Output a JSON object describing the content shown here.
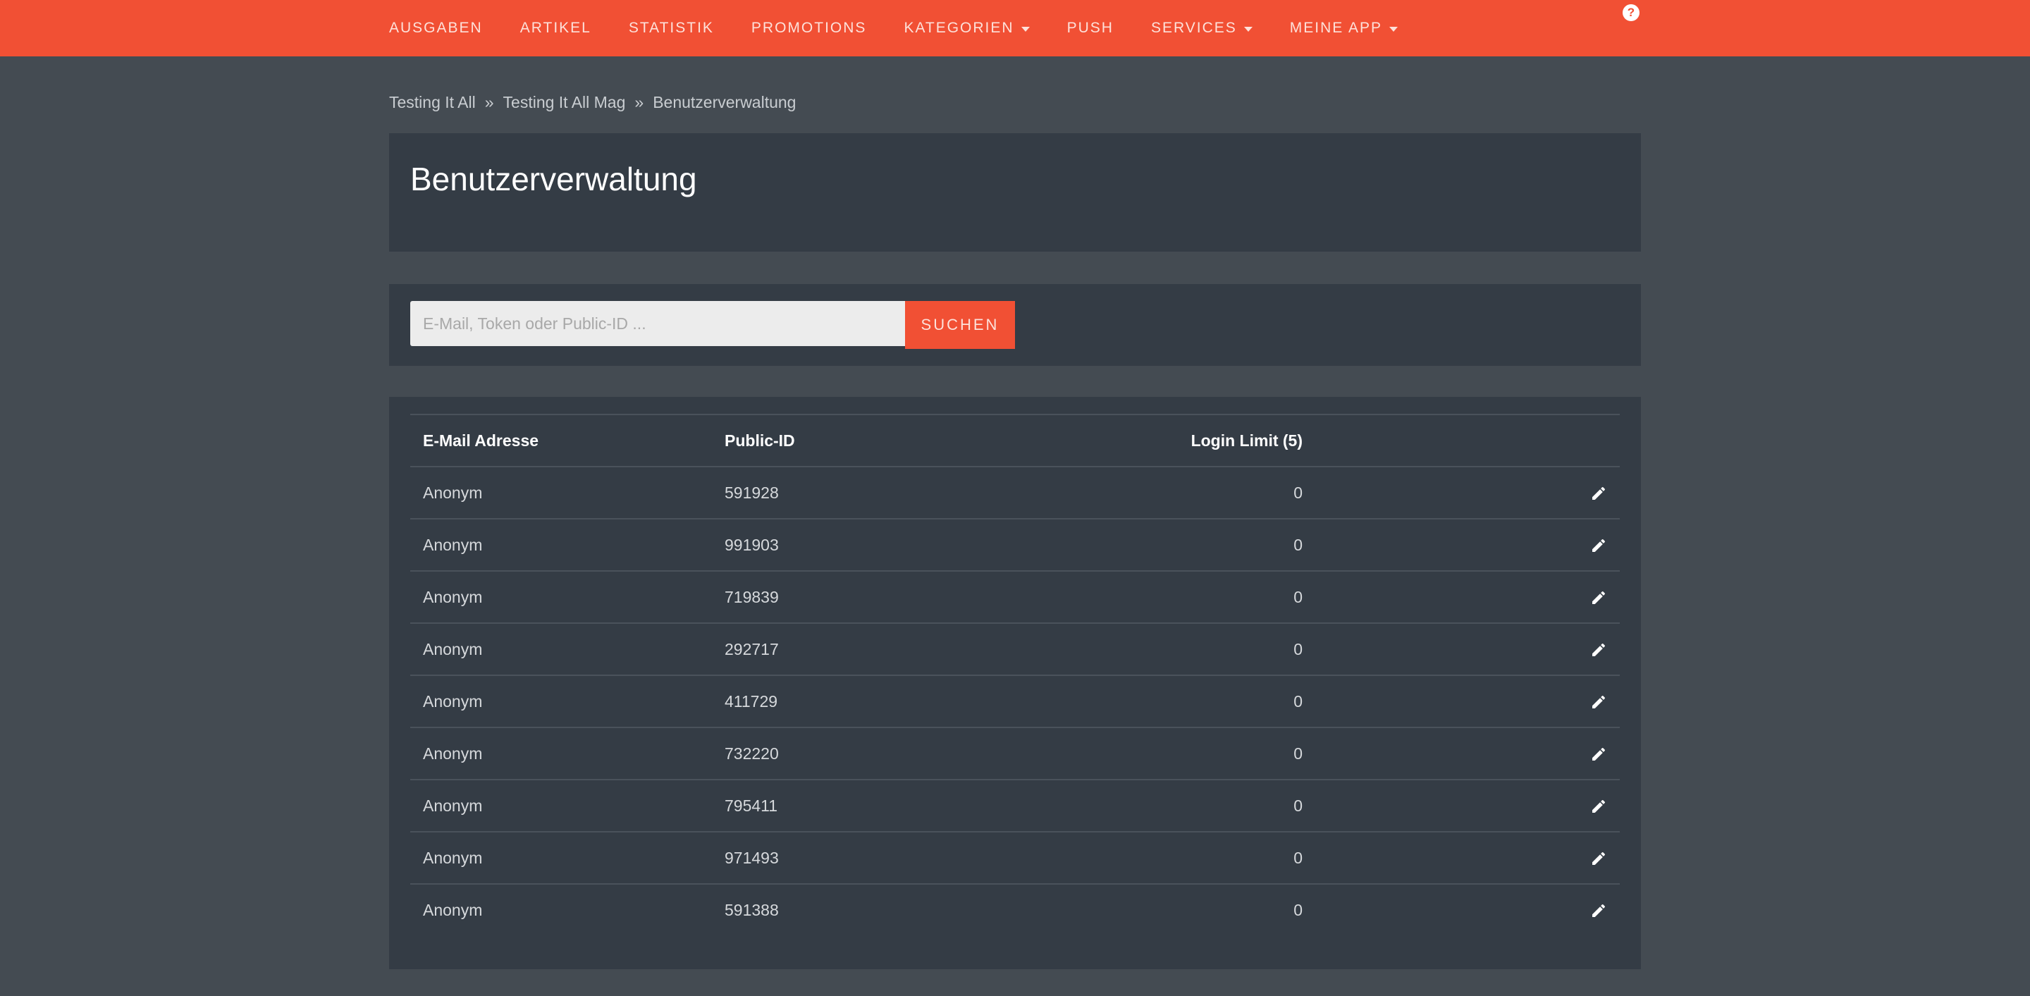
{
  "nav": {
    "items": [
      {
        "label": "AUSGABEN",
        "dropdown": false,
        "name": "nav-ausgaben"
      },
      {
        "label": "ARTIKEL",
        "dropdown": false,
        "name": "nav-artikel"
      },
      {
        "label": "STATISTIK",
        "dropdown": false,
        "name": "nav-statistik"
      },
      {
        "label": "PROMOTIONS",
        "dropdown": false,
        "name": "nav-promotions"
      },
      {
        "label": "KATEGORIEN",
        "dropdown": true,
        "name": "nav-kategorien"
      },
      {
        "label": "PUSH",
        "dropdown": false,
        "name": "nav-push"
      },
      {
        "label": "SERVICES",
        "dropdown": true,
        "name": "nav-services"
      },
      {
        "label": "MEINE APP",
        "dropdown": true,
        "name": "nav-meine-app"
      }
    ],
    "help_icon": "question-circle-icon",
    "help_glyph": "?"
  },
  "breadcrumb": {
    "items": [
      "Testing It All",
      "Testing It All Mag",
      "Benutzerverwaltung"
    ],
    "separator": "»"
  },
  "page": {
    "title": "Benutzerverwaltung"
  },
  "search": {
    "placeholder": "E-Mail, Token oder Public-ID ...",
    "value": "",
    "button_label": "SUCHEN"
  },
  "table": {
    "headers": {
      "email": "E-Mail Adresse",
      "public_id": "Public-ID",
      "login_limit": "Login Limit (5)"
    },
    "rows": [
      {
        "email": "Anonym",
        "public_id": "591928",
        "login_limit": "0"
      },
      {
        "email": "Anonym",
        "public_id": "991903",
        "login_limit": "0"
      },
      {
        "email": "Anonym",
        "public_id": "719839",
        "login_limit": "0"
      },
      {
        "email": "Anonym",
        "public_id": "292717",
        "login_limit": "0"
      },
      {
        "email": "Anonym",
        "public_id": "411729",
        "login_limit": "0"
      },
      {
        "email": "Anonym",
        "public_id": "732220",
        "login_limit": "0"
      },
      {
        "email": "Anonym",
        "public_id": "795411",
        "login_limit": "0"
      },
      {
        "email": "Anonym",
        "public_id": "971493",
        "login_limit": "0"
      },
      {
        "email": "Anonym",
        "public_id": "591388",
        "login_limit": "0"
      }
    ],
    "row_action_icon": "pencil-icon"
  },
  "colors": {
    "accent": "#f15034",
    "background": "#444b52",
    "panel": "#343c45"
  }
}
